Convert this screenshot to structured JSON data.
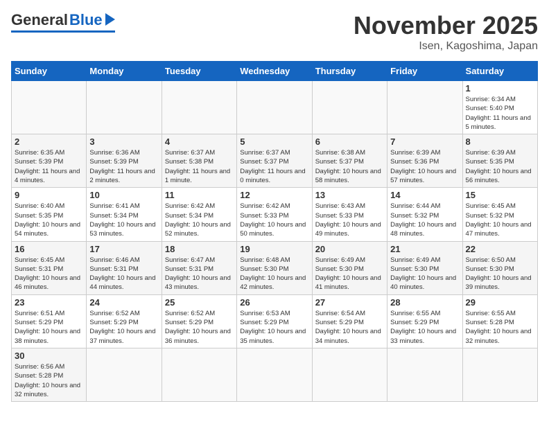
{
  "logo": {
    "general": "General",
    "blue": "Blue"
  },
  "title": {
    "month": "November 2025",
    "location": "Isen, Kagoshima, Japan"
  },
  "weekdays": [
    "Sunday",
    "Monday",
    "Tuesday",
    "Wednesday",
    "Thursday",
    "Friday",
    "Saturday"
  ],
  "weeks": [
    [
      {
        "day": "",
        "info": ""
      },
      {
        "day": "",
        "info": ""
      },
      {
        "day": "",
        "info": ""
      },
      {
        "day": "",
        "info": ""
      },
      {
        "day": "",
        "info": ""
      },
      {
        "day": "",
        "info": ""
      },
      {
        "day": "1",
        "info": "Sunrise: 6:34 AM\nSunset: 5:40 PM\nDaylight: 11 hours and 5 minutes."
      }
    ],
    [
      {
        "day": "2",
        "info": "Sunrise: 6:35 AM\nSunset: 5:39 PM\nDaylight: 11 hours and 4 minutes."
      },
      {
        "day": "3",
        "info": "Sunrise: 6:36 AM\nSunset: 5:39 PM\nDaylight: 11 hours and 2 minutes."
      },
      {
        "day": "4",
        "info": "Sunrise: 6:37 AM\nSunset: 5:38 PM\nDaylight: 11 hours and 1 minute."
      },
      {
        "day": "5",
        "info": "Sunrise: 6:37 AM\nSunset: 5:37 PM\nDaylight: 11 hours and 0 minutes."
      },
      {
        "day": "6",
        "info": "Sunrise: 6:38 AM\nSunset: 5:37 PM\nDaylight: 10 hours and 58 minutes."
      },
      {
        "day": "7",
        "info": "Sunrise: 6:39 AM\nSunset: 5:36 PM\nDaylight: 10 hours and 57 minutes."
      },
      {
        "day": "8",
        "info": "Sunrise: 6:39 AM\nSunset: 5:35 PM\nDaylight: 10 hours and 56 minutes."
      }
    ],
    [
      {
        "day": "9",
        "info": "Sunrise: 6:40 AM\nSunset: 5:35 PM\nDaylight: 10 hours and 54 minutes."
      },
      {
        "day": "10",
        "info": "Sunrise: 6:41 AM\nSunset: 5:34 PM\nDaylight: 10 hours and 53 minutes."
      },
      {
        "day": "11",
        "info": "Sunrise: 6:42 AM\nSunset: 5:34 PM\nDaylight: 10 hours and 52 minutes."
      },
      {
        "day": "12",
        "info": "Sunrise: 6:42 AM\nSunset: 5:33 PM\nDaylight: 10 hours and 50 minutes."
      },
      {
        "day": "13",
        "info": "Sunrise: 6:43 AM\nSunset: 5:33 PM\nDaylight: 10 hours and 49 minutes."
      },
      {
        "day": "14",
        "info": "Sunrise: 6:44 AM\nSunset: 5:32 PM\nDaylight: 10 hours and 48 minutes."
      },
      {
        "day": "15",
        "info": "Sunrise: 6:45 AM\nSunset: 5:32 PM\nDaylight: 10 hours and 47 minutes."
      }
    ],
    [
      {
        "day": "16",
        "info": "Sunrise: 6:45 AM\nSunset: 5:31 PM\nDaylight: 10 hours and 46 minutes."
      },
      {
        "day": "17",
        "info": "Sunrise: 6:46 AM\nSunset: 5:31 PM\nDaylight: 10 hours and 44 minutes."
      },
      {
        "day": "18",
        "info": "Sunrise: 6:47 AM\nSunset: 5:31 PM\nDaylight: 10 hours and 43 minutes."
      },
      {
        "day": "19",
        "info": "Sunrise: 6:48 AM\nSunset: 5:30 PM\nDaylight: 10 hours and 42 minutes."
      },
      {
        "day": "20",
        "info": "Sunrise: 6:49 AM\nSunset: 5:30 PM\nDaylight: 10 hours and 41 minutes."
      },
      {
        "day": "21",
        "info": "Sunrise: 6:49 AM\nSunset: 5:30 PM\nDaylight: 10 hours and 40 minutes."
      },
      {
        "day": "22",
        "info": "Sunrise: 6:50 AM\nSunset: 5:30 PM\nDaylight: 10 hours and 39 minutes."
      }
    ],
    [
      {
        "day": "23",
        "info": "Sunrise: 6:51 AM\nSunset: 5:29 PM\nDaylight: 10 hours and 38 minutes."
      },
      {
        "day": "24",
        "info": "Sunrise: 6:52 AM\nSunset: 5:29 PM\nDaylight: 10 hours and 37 minutes."
      },
      {
        "day": "25",
        "info": "Sunrise: 6:52 AM\nSunset: 5:29 PM\nDaylight: 10 hours and 36 minutes."
      },
      {
        "day": "26",
        "info": "Sunrise: 6:53 AM\nSunset: 5:29 PM\nDaylight: 10 hours and 35 minutes."
      },
      {
        "day": "27",
        "info": "Sunrise: 6:54 AM\nSunset: 5:29 PM\nDaylight: 10 hours and 34 minutes."
      },
      {
        "day": "28",
        "info": "Sunrise: 6:55 AM\nSunset: 5:29 PM\nDaylight: 10 hours and 33 minutes."
      },
      {
        "day": "29",
        "info": "Sunrise: 6:55 AM\nSunset: 5:28 PM\nDaylight: 10 hours and 32 minutes."
      }
    ],
    [
      {
        "day": "30",
        "info": "Sunrise: 6:56 AM\nSunset: 5:28 PM\nDaylight: 10 hours and 32 minutes."
      },
      {
        "day": "",
        "info": ""
      },
      {
        "day": "",
        "info": ""
      },
      {
        "day": "",
        "info": ""
      },
      {
        "day": "",
        "info": ""
      },
      {
        "day": "",
        "info": ""
      },
      {
        "day": "",
        "info": ""
      }
    ]
  ]
}
